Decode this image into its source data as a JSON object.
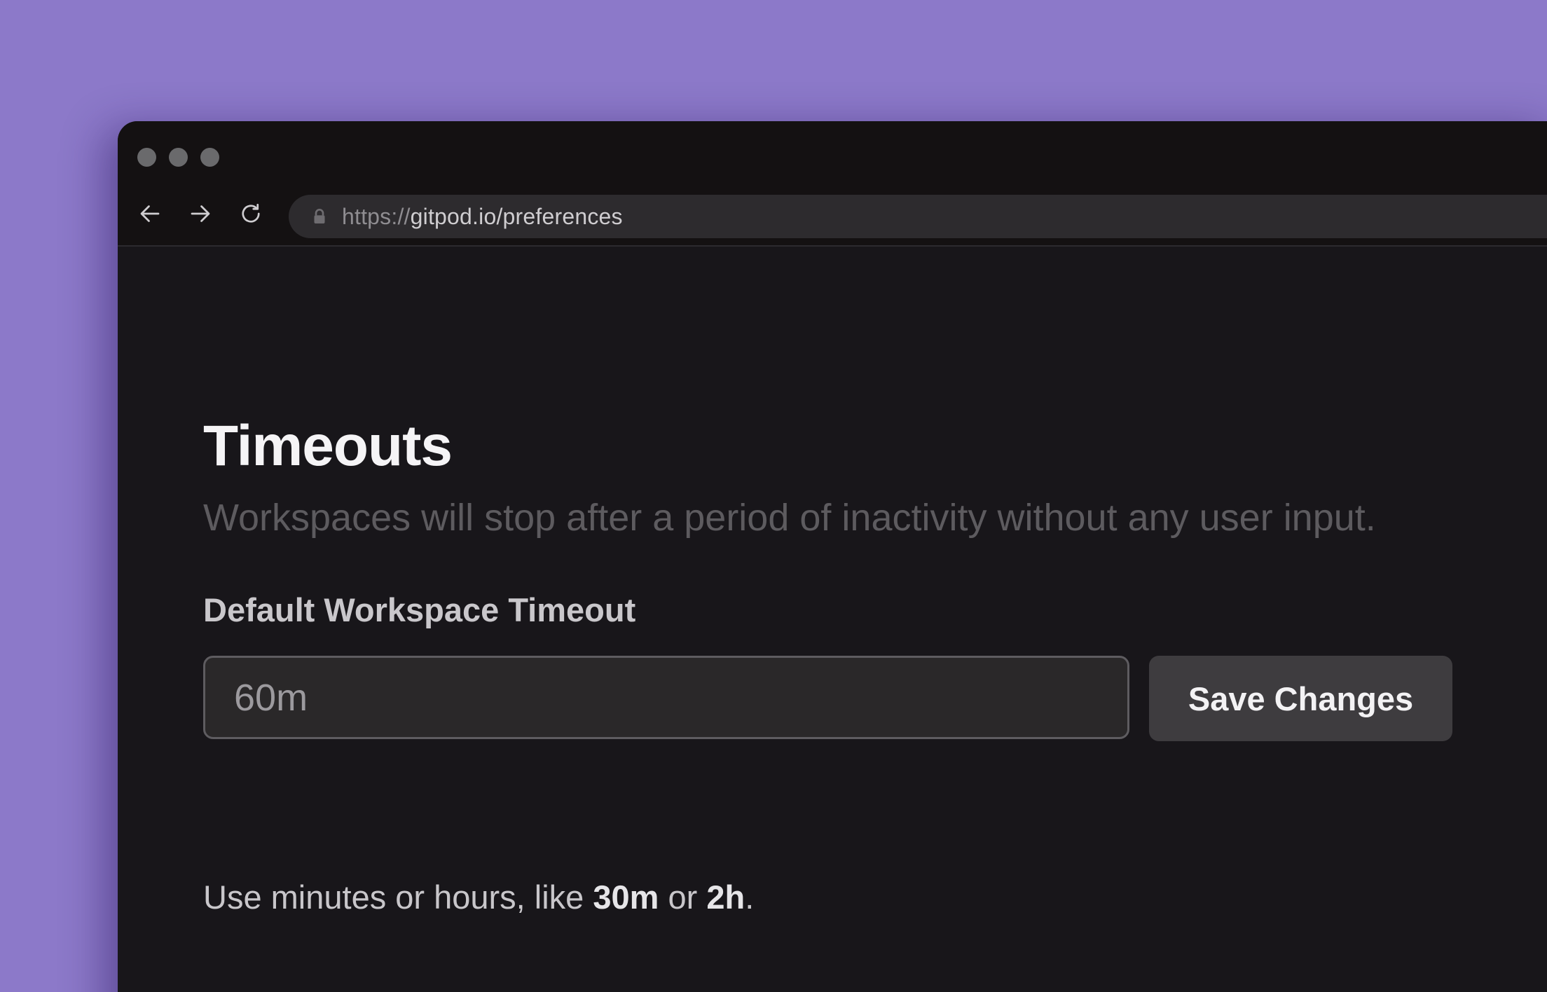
{
  "browser": {
    "url_scheme": "https://",
    "url_rest": "gitpod.io/preferences",
    "icons": {
      "back": "arrow-left-icon",
      "forward": "arrow-right-icon",
      "reload": "reload-icon",
      "lock": "lock-icon"
    }
  },
  "page": {
    "title": "Timeouts",
    "subtitle": "Workspaces will stop after a period of inactivity without any user input.",
    "field_label": "Default Workspace Timeout",
    "input_value": "60m",
    "save_label": "Save Changes",
    "hint": {
      "prefix": "Use minutes or hours, like ",
      "example1": "30m",
      "middle": " or ",
      "example2": "2h",
      "suffix": "."
    }
  },
  "colors": {
    "desktop_background": "#8c79c9",
    "window_background": "#18161a",
    "button_background": "#3e3c3f"
  }
}
